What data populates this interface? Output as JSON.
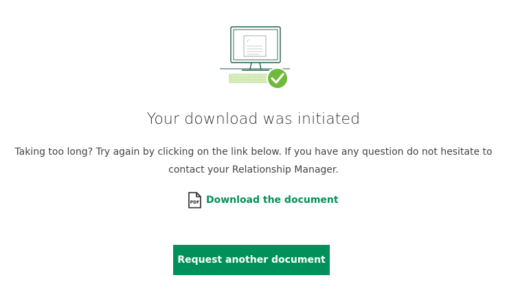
{
  "status": {
    "title": "Your download was initiated",
    "message": "Taking too long? Try again by clicking on the link below. If you have any question do not hesitate to contact your Relationship Manager."
  },
  "download_link": {
    "label": "Download the document",
    "icon": "pdf-file-icon"
  },
  "actions": {
    "request_another_label": "Request another document"
  },
  "illustration": {
    "icon": "computer-download-success-illustration",
    "badge_icon": "check-circle-icon"
  },
  "colors": {
    "brand": "#00915a",
    "check_badge": "#6fb93b",
    "keyboard": "#b8d98a",
    "text": "#333333"
  }
}
